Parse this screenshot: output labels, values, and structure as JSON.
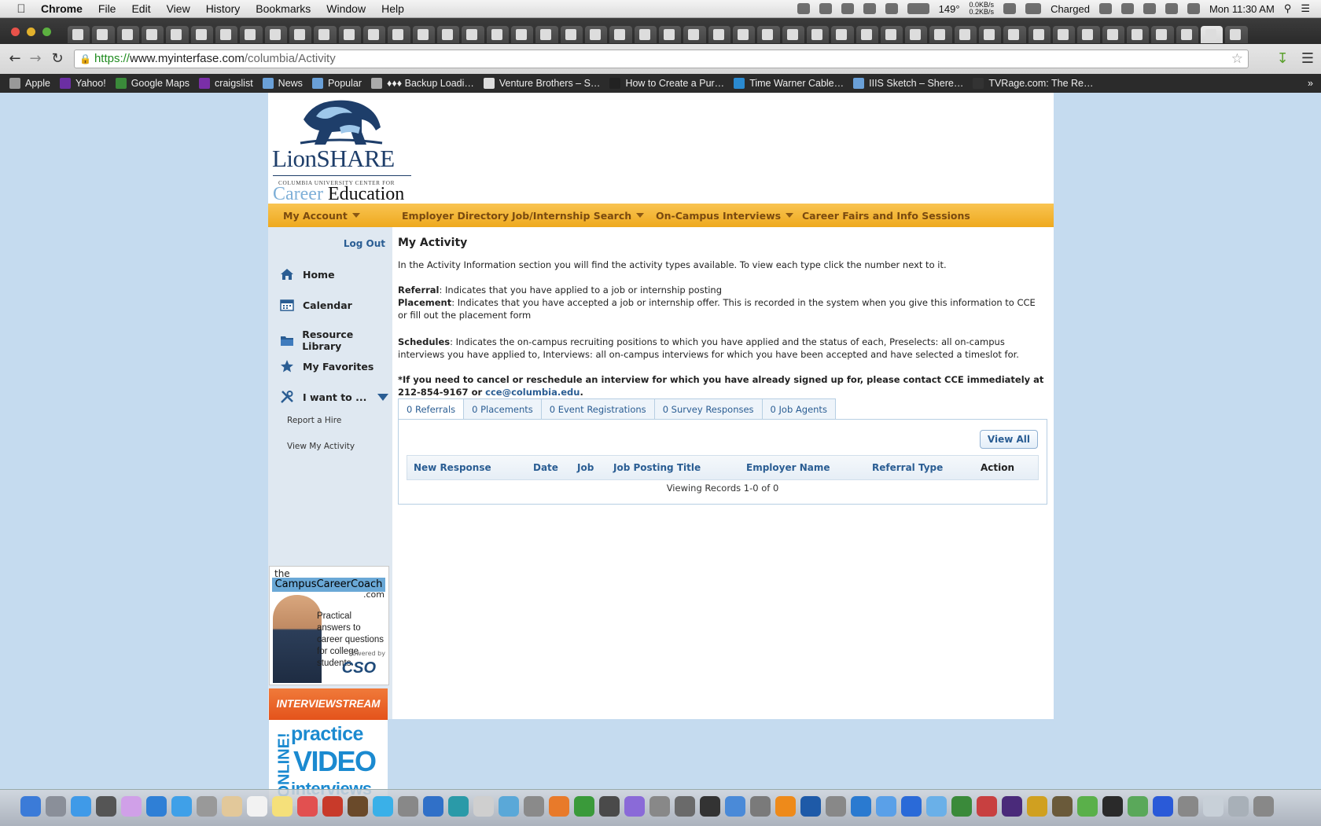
{
  "menubar": {
    "app": "Chrome",
    "items": [
      "File",
      "Edit",
      "View",
      "History",
      "Bookmarks",
      "Window",
      "Help"
    ],
    "temp": "149°",
    "net_up": "0.0KB/s",
    "net_down": "0.2KB/s",
    "battery": "Charged",
    "clock": "Mon 11:30 AM"
  },
  "browser": {
    "url_scheme": "https://",
    "url_host": "www.myinterfase.com",
    "url_path": "/columbia/Activity"
  },
  "bookmarks": [
    "Apple",
    "Yahoo!",
    "Google Maps",
    "craigslist",
    "News",
    "Popular",
    "♦♦♦ Backup Loadi…",
    "Venture Brothers – S…",
    "How to Create a Pur…",
    "Time Warner Cable…",
    "IIIS Sketch – Shere…",
    "TVRage.com: The Re…"
  ],
  "logo": {
    "title": "LionSHARE",
    "subtitle": "COLUMBIA UNIVERSITY CENTER FOR",
    "career": "Career",
    "education": "Education"
  },
  "topnav": {
    "my_account": "My Account",
    "employer_directory": "Employer Directory",
    "job_search": "Job/Internship Search",
    "on_campus": "On-Campus Interviews",
    "career_fairs": "Career Fairs and Info Sessions"
  },
  "sidebar": {
    "logout": "Log Out",
    "home": "Home",
    "calendar": "Calendar",
    "resource_library": "Resource Library",
    "my_favorites": "My Favorites",
    "i_want_to": "I want to ...",
    "report_hire": "Report a Hire",
    "view_activity": "View My Activity"
  },
  "ad_coach": {
    "the": "the",
    "name": "CampusCareerCoach",
    "dotcom": ".com",
    "pitch": "Practical answers to career questions for college students.",
    "powered": "Powered by",
    "brand": "CSO"
  },
  "ad_stream": {
    "header": "INTERVIEWSTREAM",
    "online": "ONLINE!",
    "practice": "practice",
    "video": "VIDEO",
    "interviews": "interviews"
  },
  "main": {
    "title": "My Activity",
    "intro": "In the Activity Information section you will find the activity types available. To view each type click the number next to it.",
    "referral_label": "Referral",
    "referral_text": ": Indicates that you have applied to a job or internship posting",
    "placement_label": "Placement",
    "placement_text": ": Indicates that you have accepted a job or internship offer. This is recorded in the system when you give this information to CCE or fill out the placement form",
    "schedules_label": "Schedules",
    "schedules_text": ": Indicates the on-campus recruiting positions to which you have applied and the status of each, Preselects: all on-campus interviews you have applied to, Interviews: all on-campus interviews for which you have been accepted and have selected a timeslot for.",
    "notice": "*If you need to cancel or reschedule an interview for which you have already signed up for, please contact CCE immediately at 212-854-9167 or",
    "email": "cce@columbia.edu",
    "tabs": [
      "0 Referrals",
      "0 Placements",
      "0 Event Registrations",
      "0 Survey Responses",
      "0 Job Agents"
    ],
    "view_all": "View All",
    "columns": [
      "New Response",
      "Date",
      "Job",
      "Job Posting Title",
      "Employer Name",
      "Referral Type",
      "Action"
    ],
    "records": "Viewing Records 1-0 of 0"
  }
}
